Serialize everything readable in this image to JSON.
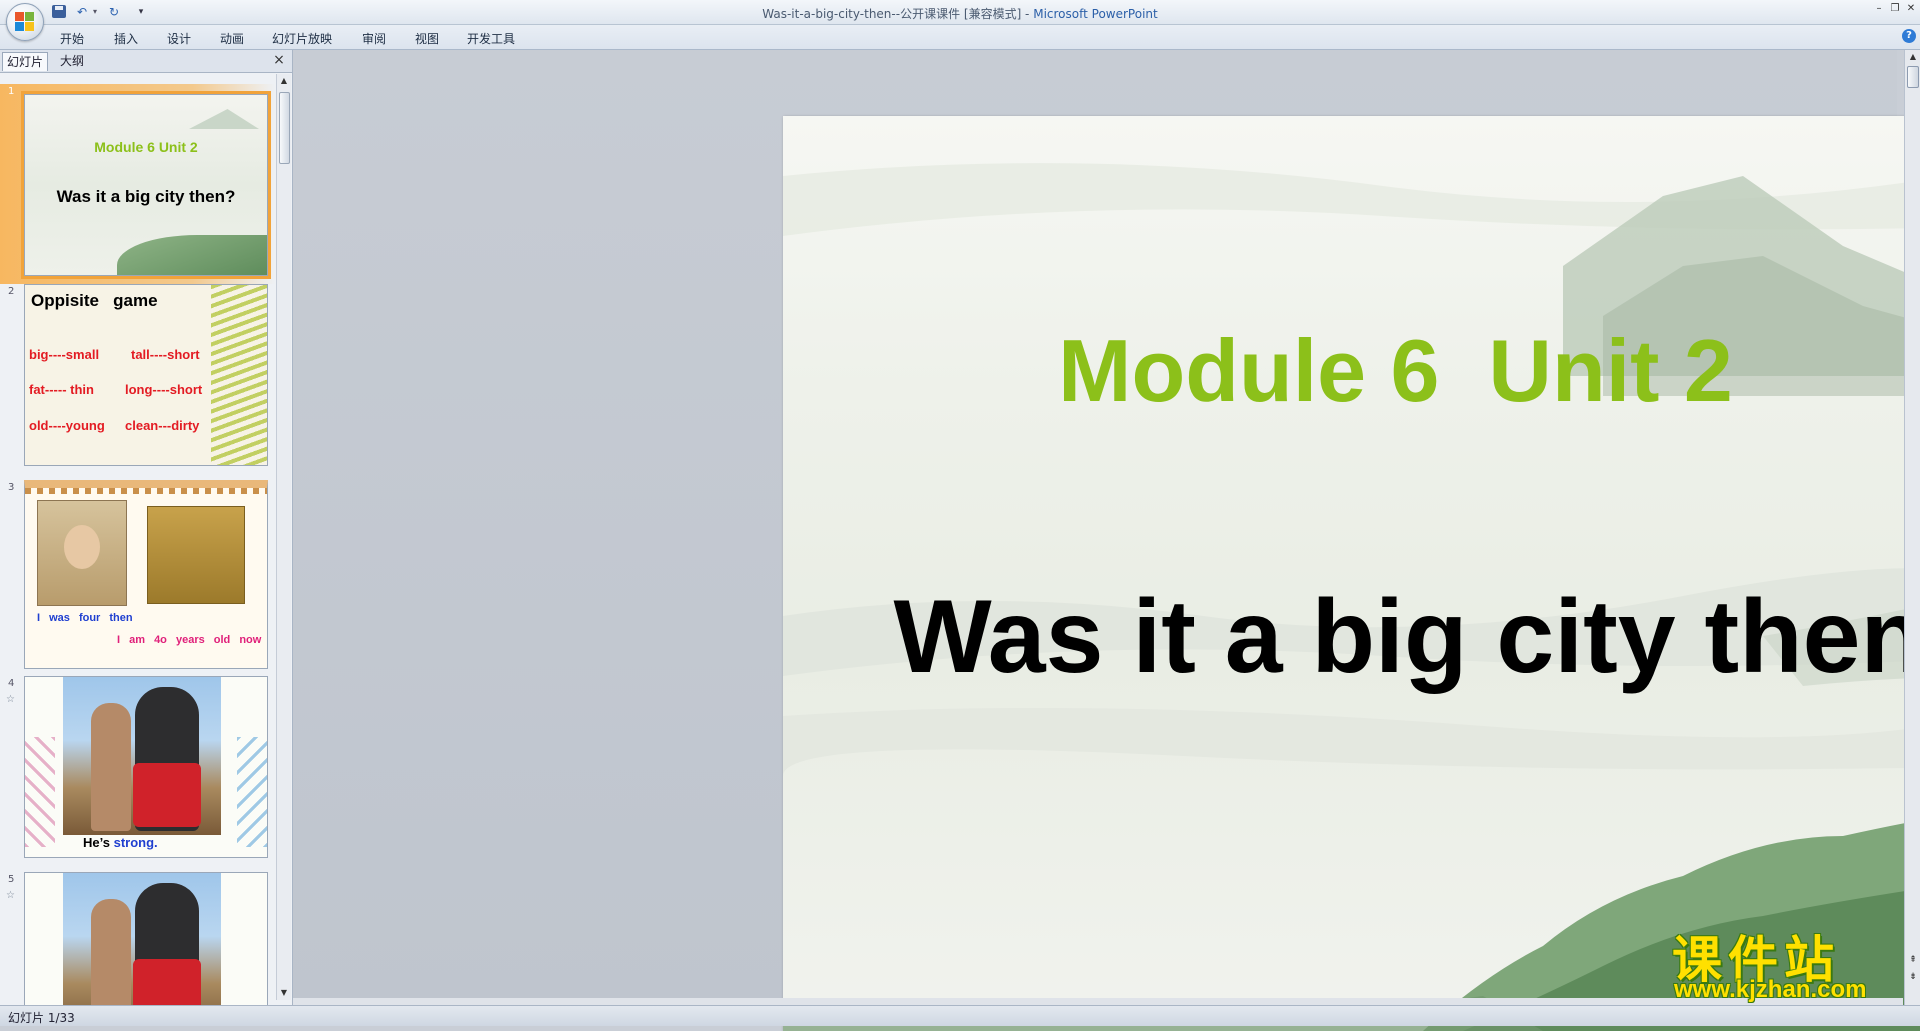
{
  "window": {
    "title": "Was-it-a-big-city-then--公开课课件 [兼容模式] - ",
    "app_name": "Microsoft PowerPoint"
  },
  "quick_access": {
    "save_icon": "save-icon",
    "undo_icon": "undo-icon",
    "redo_icon": "redo-icon"
  },
  "ribbon": {
    "tabs": [
      "开始",
      "插入",
      "设计",
      "动画",
      "幻灯片放映",
      "审阅",
      "视图",
      "开发工具"
    ]
  },
  "panel": {
    "tabs": [
      "幻灯片",
      "大纲"
    ],
    "close_glyph": "×"
  },
  "thumbnails": [
    {
      "number": "1",
      "module": "Module 6  Unit 2",
      "title": "Was it a big city then?"
    },
    {
      "number": "2",
      "heading": "Oppisite   game",
      "pairs": [
        "big----small",
        "tall----short",
        "fat----- thin",
        "long----short",
        "old----young",
        "clean---dirty"
      ]
    },
    {
      "number": "3",
      "line1": "I was four then",
      "line2": "I am 4o years old now"
    },
    {
      "number": "4",
      "caption_prefix": "He’s ",
      "caption_word": "strong."
    },
    {
      "number": "5"
    }
  ],
  "slide": {
    "module": "Module 6  Unit 2",
    "title": "Was it a big city then?",
    "colors": {
      "module": "#8cc01a",
      "title": "#000000"
    }
  },
  "status": {
    "slide_indicator": "幻灯片 1/33"
  },
  "watermark": {
    "chinese": "课件站",
    "url": "www.kjzhan.com"
  }
}
